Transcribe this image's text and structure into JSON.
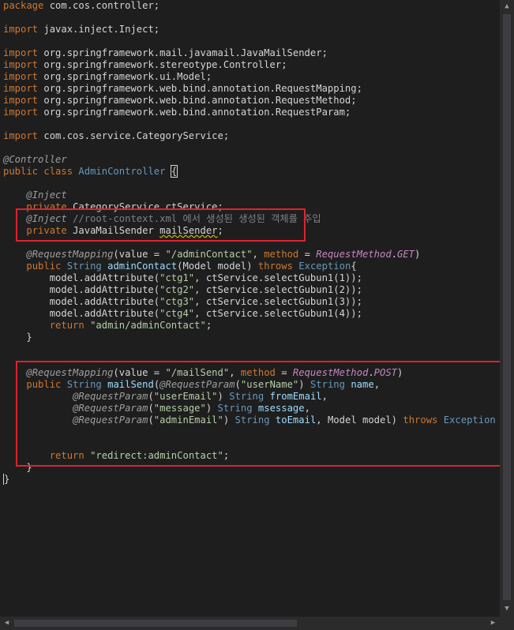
{
  "editor": {
    "lines": [
      {
        "tokens": [
          [
            "kw",
            "package"
          ],
          [
            "pl",
            " com.cos.controller;"
          ]
        ]
      },
      {
        "tokens": []
      },
      {
        "tokens": [
          [
            "kw",
            "import"
          ],
          [
            "pl",
            " javax.inject.Inject;"
          ]
        ]
      },
      {
        "tokens": []
      },
      {
        "tokens": [
          [
            "kw",
            "import"
          ],
          [
            "pl",
            " org.springframework.mail.javamail.JavaMailSender;"
          ]
        ]
      },
      {
        "tokens": [
          [
            "kw",
            "import"
          ],
          [
            "pl",
            " org.springframework.stereotype.Controller;"
          ]
        ]
      },
      {
        "tokens": [
          [
            "kw",
            "import"
          ],
          [
            "pl",
            " org.springframework.ui.Model;"
          ]
        ]
      },
      {
        "tokens": [
          [
            "kw",
            "import"
          ],
          [
            "pl",
            " org.springframework.web.bind.annotation.RequestMapping;"
          ]
        ]
      },
      {
        "tokens": [
          [
            "kw",
            "import"
          ],
          [
            "pl",
            " org.springframework.web.bind.annotation.RequestMethod;"
          ]
        ]
      },
      {
        "tokens": [
          [
            "kw",
            "import"
          ],
          [
            "pl",
            " org.springframework.web.bind.annotation.RequestParam;"
          ]
        ]
      },
      {
        "tokens": []
      },
      {
        "tokens": [
          [
            "kw",
            "import"
          ],
          [
            "pl",
            " com.cos.service.CategoryService;"
          ]
        ]
      },
      {
        "tokens": []
      },
      {
        "tokens": [
          [
            "ann",
            "@Controller"
          ]
        ]
      },
      {
        "tokens": [
          [
            "kw",
            "public"
          ],
          [
            "pl",
            " "
          ],
          [
            "kw",
            "class"
          ],
          [
            "pl",
            " "
          ],
          [
            "typ",
            "AdminController"
          ],
          [
            "pl",
            " "
          ],
          [
            "bracebox",
            "{"
          ]
        ]
      },
      {
        "tokens": []
      },
      {
        "tokens": [
          [
            "pl",
            "    "
          ],
          [
            "ann",
            "@Inject"
          ]
        ]
      },
      {
        "tokens": [
          [
            "pl",
            "    "
          ],
          [
            "kw",
            "private"
          ],
          [
            "pl",
            " CategoryService "
          ],
          [
            "fld",
            "ctService"
          ],
          [
            "pl",
            ";"
          ]
        ]
      },
      {
        "tokens": [
          [
            "pl",
            "    "
          ],
          [
            "ann",
            "@Inject"
          ],
          [
            "pl",
            " "
          ],
          [
            "cmt",
            "//root-context.xml 에서 생성된 생성된 객체를 주입"
          ]
        ]
      },
      {
        "tokens": [
          [
            "pl",
            "    "
          ],
          [
            "kw",
            "private"
          ],
          [
            "pl",
            " JavaMailSender "
          ],
          [
            "squig",
            "mailSender"
          ],
          [
            "pl",
            ";"
          ]
        ]
      },
      {
        "tokens": []
      },
      {
        "tokens": [
          [
            "pl",
            "    "
          ],
          [
            "ann",
            "@RequestMapping"
          ],
          [
            "pl",
            "(value = "
          ],
          [
            "str2",
            "\"/adminContact\""
          ],
          [
            "pl",
            ", "
          ],
          [
            "kw",
            "method"
          ],
          [
            "pl",
            " = "
          ],
          [
            "enum",
            "RequestMethod"
          ],
          [
            "pl",
            "."
          ],
          [
            "enum",
            "GET"
          ],
          [
            "pl",
            ")"
          ]
        ]
      },
      {
        "tokens": [
          [
            "pl",
            "    "
          ],
          [
            "kw",
            "public"
          ],
          [
            "pl",
            " "
          ],
          [
            "typ",
            "String"
          ],
          [
            "pl",
            " "
          ],
          [
            "cls",
            "adminContact"
          ],
          [
            "pl",
            "(Model model) "
          ],
          [
            "kw",
            "throws"
          ],
          [
            "pl",
            " "
          ],
          [
            "typ",
            "Exception"
          ],
          [
            "pl",
            "{"
          ]
        ]
      },
      {
        "tokens": [
          [
            "pl",
            "        model.addAttribute("
          ],
          [
            "str2",
            "\"ctg1\""
          ],
          [
            "pl",
            ", ctService.selectGubun1(1));"
          ]
        ]
      },
      {
        "tokens": [
          [
            "pl",
            "        model.addAttribute("
          ],
          [
            "str2",
            "\"ctg2\""
          ],
          [
            "pl",
            ", ctService.selectGubun1(2));"
          ]
        ]
      },
      {
        "tokens": [
          [
            "pl",
            "        model.addAttribute("
          ],
          [
            "str2",
            "\"ctg3\""
          ],
          [
            "pl",
            ", ctService.selectGubun1(3));"
          ]
        ]
      },
      {
        "tokens": [
          [
            "pl",
            "        model.addAttribute("
          ],
          [
            "str2",
            "\"ctg4\""
          ],
          [
            "pl",
            ", ctService.selectGubun1(4));"
          ]
        ]
      },
      {
        "tokens": [
          [
            "pl",
            "        "
          ],
          [
            "kw",
            "return"
          ],
          [
            "pl",
            " "
          ],
          [
            "str2",
            "\"admin/adminContact\""
          ],
          [
            "pl",
            ";"
          ]
        ]
      },
      {
        "tokens": [
          [
            "pl",
            "    }"
          ]
        ]
      },
      {
        "tokens": []
      },
      {
        "tokens": []
      },
      {
        "tokens": [
          [
            "pl",
            "    "
          ],
          [
            "ann",
            "@RequestMapping"
          ],
          [
            "pl",
            "(value = "
          ],
          [
            "str2",
            "\"/mailSend\""
          ],
          [
            "pl",
            ", "
          ],
          [
            "kw",
            "method"
          ],
          [
            "pl",
            " = "
          ],
          [
            "enum",
            "RequestMethod"
          ],
          [
            "pl",
            "."
          ],
          [
            "enum",
            "POST"
          ],
          [
            "pl",
            ")"
          ]
        ]
      },
      {
        "tokens": [
          [
            "pl",
            "    "
          ],
          [
            "kw",
            "public"
          ],
          [
            "pl",
            " "
          ],
          [
            "typ",
            "String"
          ],
          [
            "pl",
            " "
          ],
          [
            "cls",
            "mailSend"
          ],
          [
            "pl",
            "("
          ],
          [
            "ann",
            "@RequestParam"
          ],
          [
            "pl",
            "("
          ],
          [
            "str2",
            "\"userName\""
          ],
          [
            "pl",
            ") "
          ],
          [
            "typ",
            "String"
          ],
          [
            "pl",
            " "
          ],
          [
            "cls",
            "name"
          ],
          [
            "pl",
            ","
          ]
        ]
      },
      {
        "tokens": [
          [
            "pl",
            "            "
          ],
          [
            "ann",
            "@RequestParam"
          ],
          [
            "pl",
            "("
          ],
          [
            "str2",
            "\"userEmail\""
          ],
          [
            "pl",
            ") "
          ],
          [
            "typ",
            "String"
          ],
          [
            "pl",
            " "
          ],
          [
            "cls",
            "fromEmail"
          ],
          [
            "pl",
            ","
          ]
        ]
      },
      {
        "tokens": [
          [
            "pl",
            "            "
          ],
          [
            "ann",
            "@RequestParam"
          ],
          [
            "pl",
            "("
          ],
          [
            "str2",
            "\"message\""
          ],
          [
            "pl",
            ") "
          ],
          [
            "typ",
            "String"
          ],
          [
            "pl",
            " "
          ],
          [
            "cls",
            "msessage"
          ],
          [
            "pl",
            ","
          ]
        ]
      },
      {
        "tokens": [
          [
            "pl",
            "            "
          ],
          [
            "ann",
            "@RequestParam"
          ],
          [
            "pl",
            "("
          ],
          [
            "str2",
            "\"adminEmail\""
          ],
          [
            "pl",
            ") "
          ],
          [
            "typ",
            "String"
          ],
          [
            "pl",
            " "
          ],
          [
            "cls",
            "toEmail"
          ],
          [
            "pl",
            ", Model model) "
          ],
          [
            "kw",
            "throws"
          ],
          [
            "pl",
            " "
          ],
          [
            "typ",
            "Exception"
          ],
          [
            "pl",
            " {"
          ]
        ]
      },
      {
        "tokens": []
      },
      {
        "tokens": []
      },
      {
        "tokens": [
          [
            "pl",
            "        "
          ],
          [
            "kw",
            "return"
          ],
          [
            "pl",
            " "
          ],
          [
            "str2",
            "\"redirect:adminContact\""
          ],
          [
            "pl",
            ";"
          ]
        ]
      },
      {
        "tokens": [
          [
            "pl",
            "    }"
          ]
        ]
      },
      {
        "tokens": [
          [
            "caret",
            "}"
          ]
        ]
      }
    ]
  },
  "scrollbars": {
    "up_arrow": "▲",
    "down_arrow": "▼",
    "left_arrow": "◀",
    "right_arrow": "▶"
  }
}
